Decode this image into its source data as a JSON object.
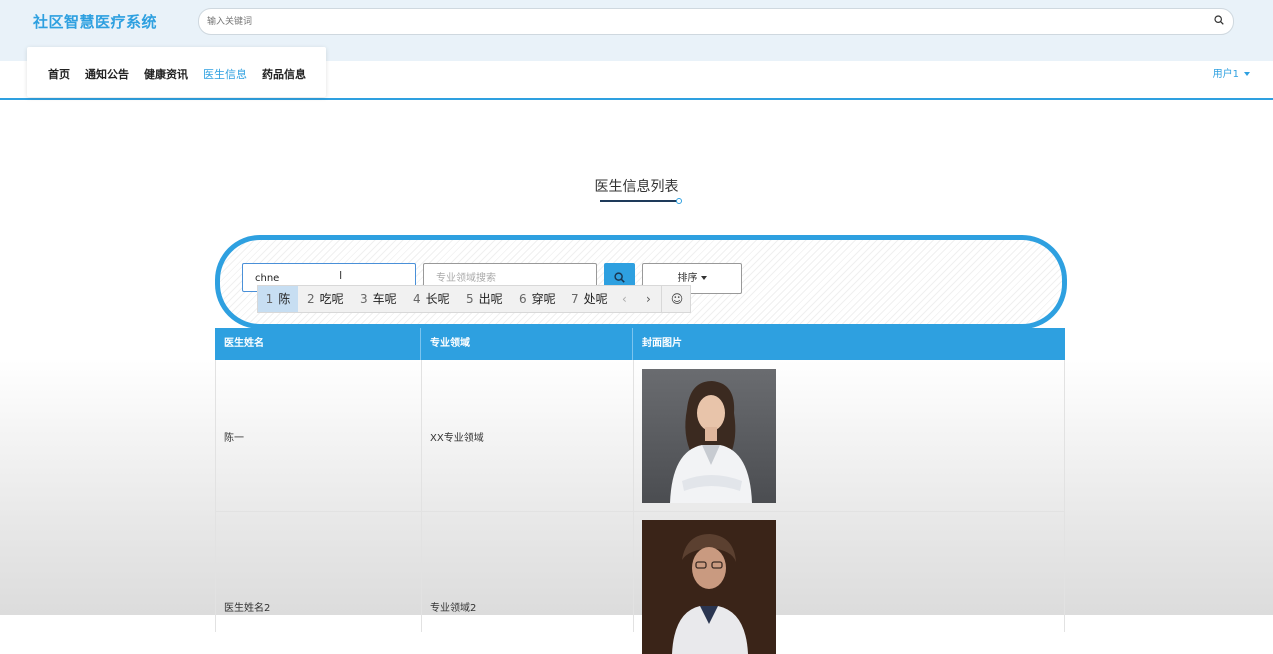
{
  "header": {
    "logo": "社区智慧医疗系统",
    "search_placeholder": "输入关键词"
  },
  "nav": {
    "items": [
      {
        "label": "首页"
      },
      {
        "label": "通知公告"
      },
      {
        "label": "健康资讯"
      },
      {
        "label": "医生信息"
      },
      {
        "label": "药品信息"
      }
    ],
    "active_index": 3,
    "user": "用户1"
  },
  "page": {
    "title": "医生信息列表"
  },
  "filter": {
    "name_value": "chne",
    "specialty_placeholder": "专业领域搜索",
    "sort_label": "排序"
  },
  "ime": {
    "candidates": [
      {
        "num": "1",
        "text": "陈"
      },
      {
        "num": "2",
        "text": "吃呢"
      },
      {
        "num": "3",
        "text": "车呢"
      },
      {
        "num": "4",
        "text": "长呢"
      },
      {
        "num": "5",
        "text": "出呢"
      },
      {
        "num": "6",
        "text": "穿呢"
      },
      {
        "num": "7",
        "text": "处呢"
      }
    ],
    "prev": "‹",
    "next": "›",
    "emoji": "☺"
  },
  "table": {
    "headers": [
      "医生姓名",
      "专业领域",
      "封面图片"
    ],
    "rows": [
      {
        "name": "陈一",
        "specialty": "XX专业领域",
        "image": "doctor-photo-female-1"
      },
      {
        "name": "医生姓名2",
        "specialty": "专业领域2",
        "image": "doctor-photo-female-2"
      }
    ]
  },
  "colors": {
    "accent": "#2ea0e0",
    "header_bg": "#e9f2f9"
  }
}
